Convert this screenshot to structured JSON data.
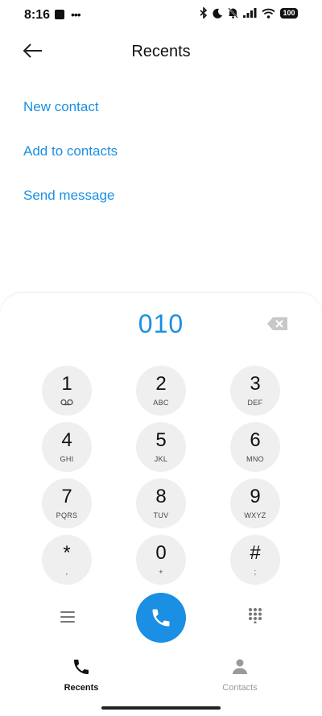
{
  "status_bar": {
    "time": "8:16",
    "battery": "100"
  },
  "header": {
    "title": "Recents"
  },
  "actions": [
    {
      "label": "New contact"
    },
    {
      "label": "Add to contacts"
    },
    {
      "label": "Send message"
    }
  ],
  "dialer": {
    "number": "010",
    "keys": [
      {
        "digit": "1",
        "letters": ""
      },
      {
        "digit": "2",
        "letters": "ABC"
      },
      {
        "digit": "3",
        "letters": "DEF"
      },
      {
        "digit": "4",
        "letters": "GHI"
      },
      {
        "digit": "5",
        "letters": "JKL"
      },
      {
        "digit": "6",
        "letters": "MNO"
      },
      {
        "digit": "7",
        "letters": "PQRS"
      },
      {
        "digit": "8",
        "letters": "TUV"
      },
      {
        "digit": "9",
        "letters": "WXYZ"
      },
      {
        "digit": "*",
        "letters": ","
      },
      {
        "digit": "0",
        "letters": "+"
      },
      {
        "digit": "#",
        "letters": ";"
      }
    ]
  },
  "tabs": [
    {
      "label": "Recents",
      "icon": "phone-icon",
      "active": true
    },
    {
      "label": "Contacts",
      "icon": "person-icon",
      "active": false
    }
  ],
  "colors": {
    "accent": "#1a8fe3",
    "key_background": "#efefef"
  }
}
